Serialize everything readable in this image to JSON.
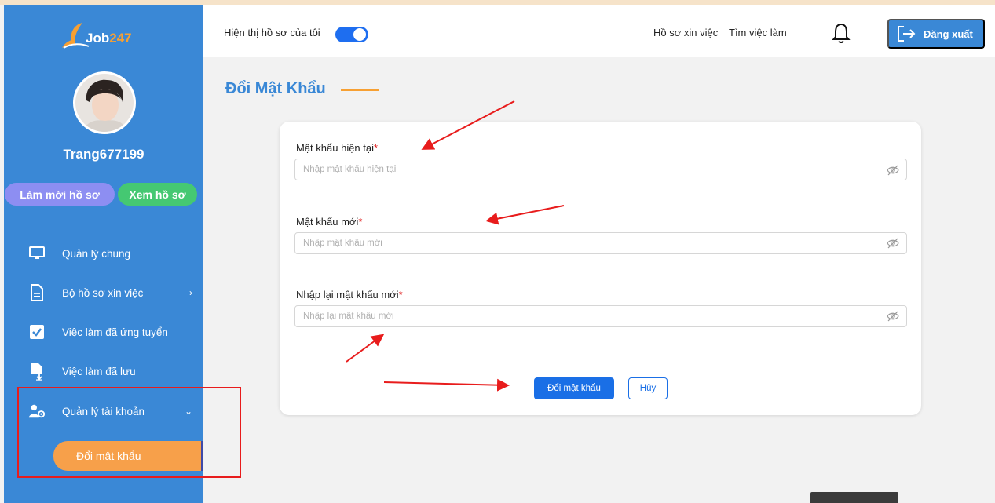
{
  "brand": {
    "logo_text_a": "Job",
    "logo_text_b": "247"
  },
  "sidebar": {
    "username": "Trang677199",
    "refresh_label": "Làm mới hồ sơ",
    "view_label": "Xem hồ sơ",
    "items": [
      {
        "label": "Quản lý chung",
        "icon": "monitor-icon"
      },
      {
        "label": "Bộ hồ sơ xin việc",
        "icon": "document-icon",
        "chevron": "›"
      },
      {
        "label": "Việc làm đã ứng tuyển",
        "icon": "checkbox-icon"
      },
      {
        "label": "Việc làm đã lưu",
        "icon": "file-download-icon"
      },
      {
        "label": "Quản lý tài khoản",
        "icon": "user-settings-icon",
        "chevron": "⌄"
      }
    ],
    "sub_item": "Đổi mật khẩu"
  },
  "header": {
    "toggle_label": "Hiện thị hồ sơ của tôi",
    "toggle_on": true,
    "link_profile": "Hồ sơ xin việc",
    "link_jobs": "Tìm việc làm",
    "logout_label": "Đăng xuất"
  },
  "main": {
    "title": "Đổi Mật Khẩu",
    "fields": [
      {
        "label": "Mật khẩu hiện tại",
        "required_mark": "*",
        "placeholder": "Nhập mật khẩu hiện tại"
      },
      {
        "label": "Mật khẩu mới",
        "required_mark": "*",
        "placeholder": "Nhập mật khẩu mới"
      },
      {
        "label": "Nhập lại mật khẩu mới",
        "required_mark": "*",
        "placeholder": "Nhập lại mật khẩu mới"
      }
    ],
    "submit_label": "Đổi mật khẩu",
    "cancel_label": "Hủy"
  },
  "colors": {
    "sidebar": "#3a88d6",
    "accent_orange": "#f7a033",
    "primary_button": "#1a6fe6",
    "annotation_red": "#e81c1c"
  }
}
